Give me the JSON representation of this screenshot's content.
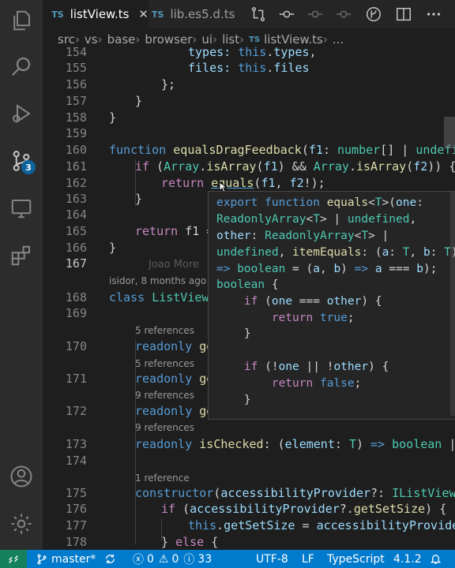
{
  "colors": {
    "accent": "#007acc",
    "remote": "#16825d",
    "badge": "#0e639c",
    "ts_icon": "#519aba"
  },
  "activity_bar": {
    "scm_badge": "3"
  },
  "tabs": [
    {
      "icon_text": "TS",
      "label": "listView.ts",
      "active": true
    },
    {
      "icon_text": "TS",
      "label": "lib.es5.d.ts",
      "active": false
    }
  ],
  "breadcrumb": {
    "items": [
      "src",
      "vs",
      "base",
      "browser",
      "ui",
      "list"
    ],
    "file_icon": "TS",
    "file": "listView.ts",
    "more": "..."
  },
  "gutter": {
    "lines": [
      "154",
      "155",
      "156",
      "157",
      "158",
      "159",
      "160",
      "161",
      "162",
      "163",
      "164",
      "165",
      "166",
      "167",
      "168",
      "169",
      "170",
      "171",
      "172",
      "173",
      "174",
      "175",
      "176",
      "177",
      "178"
    ]
  },
  "code": {
    "l154": [
      "types: ",
      "this",
      ".",
      "types",
      ","
    ],
    "l155": [
      "files: ",
      "this",
      ".",
      "files"
    ],
    "l156": "};",
    "l157": "}",
    "l158": "}",
    "l160": [
      "function",
      " ",
      "equalsDragFeedback",
      "(",
      "f1",
      ": ",
      "number",
      "[] | ",
      "undefined",
      ","
    ],
    "l161": [
      "if",
      " (",
      "Array",
      ".",
      "isArray",
      "(",
      "f1",
      ") && ",
      "Array",
      ".",
      "isArray",
      "(",
      "f2",
      ")) {"
    ],
    "l162": [
      "return",
      " ",
      "equals",
      "(",
      "f1",
      ", ",
      "f2",
      "!);"
    ],
    "l163": "}",
    "l165": [
      "return",
      " f1 ="
    ],
    "l166": "}",
    "l167_blame": "Joao More",
    "l167_blame_sub": "isidor, 8 months ago | 2 a",
    "l168": [
      "class",
      " ",
      "ListViewA"
    ],
    "l170": [
      "readonly",
      " ge"
    ],
    "l171": [
      "readonly",
      " ge"
    ],
    "l172": [
      "readonly",
      " ge"
    ],
    "l173": [
      "readonly",
      " ",
      "isChecked",
      ": (",
      "element",
      ": ",
      "T",
      ") ",
      "=>",
      " ",
      "boolean",
      " | ",
      "und"
    ],
    "l175": [
      "constructor",
      "(",
      "accessibilityProvider",
      "?: ",
      "IListViewAcce"
    ],
    "l176": [
      "if",
      " (",
      "accessibilityProvider",
      "?.",
      "getSetSize",
      ") {"
    ],
    "l177": [
      "this",
      ".",
      "getSetSize",
      " = ",
      "accessibilityProvider",
      ".g"
    ],
    "l178": [
      "} ",
      "else",
      " {"
    ]
  },
  "code_lens": {
    "r170": "5 references",
    "r171": "5 references",
    "r172": "9 references",
    "r173": "9 references",
    "r175": "1 reference"
  },
  "hover": {
    "lines": [
      [
        "export",
        " ",
        "function",
        " ",
        "equals",
        "<",
        "T",
        ">(",
        "one",
        ":"
      ],
      [
        "ReadonlyArray",
        "<",
        "T",
        "> | ",
        "undefined",
        ","
      ],
      [
        "other",
        ": ",
        "ReadonlyArray",
        "<",
        "T",
        "> |"
      ],
      [
        "undefined",
        ", ",
        "itemEquals",
        ": (",
        "a",
        ": ",
        "T",
        ", ",
        "b",
        ": ",
        "T",
        ")"
      ],
      [
        "=>",
        " ",
        "boolean",
        " = (",
        "a",
        ", ",
        "b",
        ") ",
        "=>",
        " ",
        "a",
        " === ",
        "b",
        ");"
      ],
      [
        "boolean",
        " {"
      ],
      [
        "    ",
        "if",
        " (",
        "one",
        " === ",
        "other",
        ") {"
      ],
      [
        "        ",
        "return",
        " ",
        "true",
        ";"
      ],
      [
        "    }"
      ],
      [
        ""
      ],
      [
        "    ",
        "if",
        " (!",
        "one",
        " || !",
        "other",
        ") {"
      ],
      [
        "        ",
        "return",
        " ",
        "false",
        ";"
      ],
      [
        "    }"
      ]
    ]
  },
  "status": {
    "branch": "master*",
    "errors": "0",
    "warnings": "0",
    "info": "33",
    "encoding": "UTF-8",
    "eol": "LF",
    "language": "TypeScript",
    "version": "4.1.2"
  }
}
